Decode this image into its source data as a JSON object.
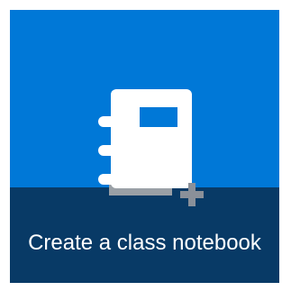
{
  "tile": {
    "label": "Create a class notebook",
    "icon": "notebook-add-icon",
    "colors": {
      "top_background": "#0078d7",
      "bottom_background": "#083a66",
      "notebook_body": "#ffffff",
      "notebook_label": "#0078d7",
      "notebook_spine_shadow": "#9aa0a6",
      "plus_sign": "#8a9099",
      "label_text": "#ffffff"
    }
  }
}
